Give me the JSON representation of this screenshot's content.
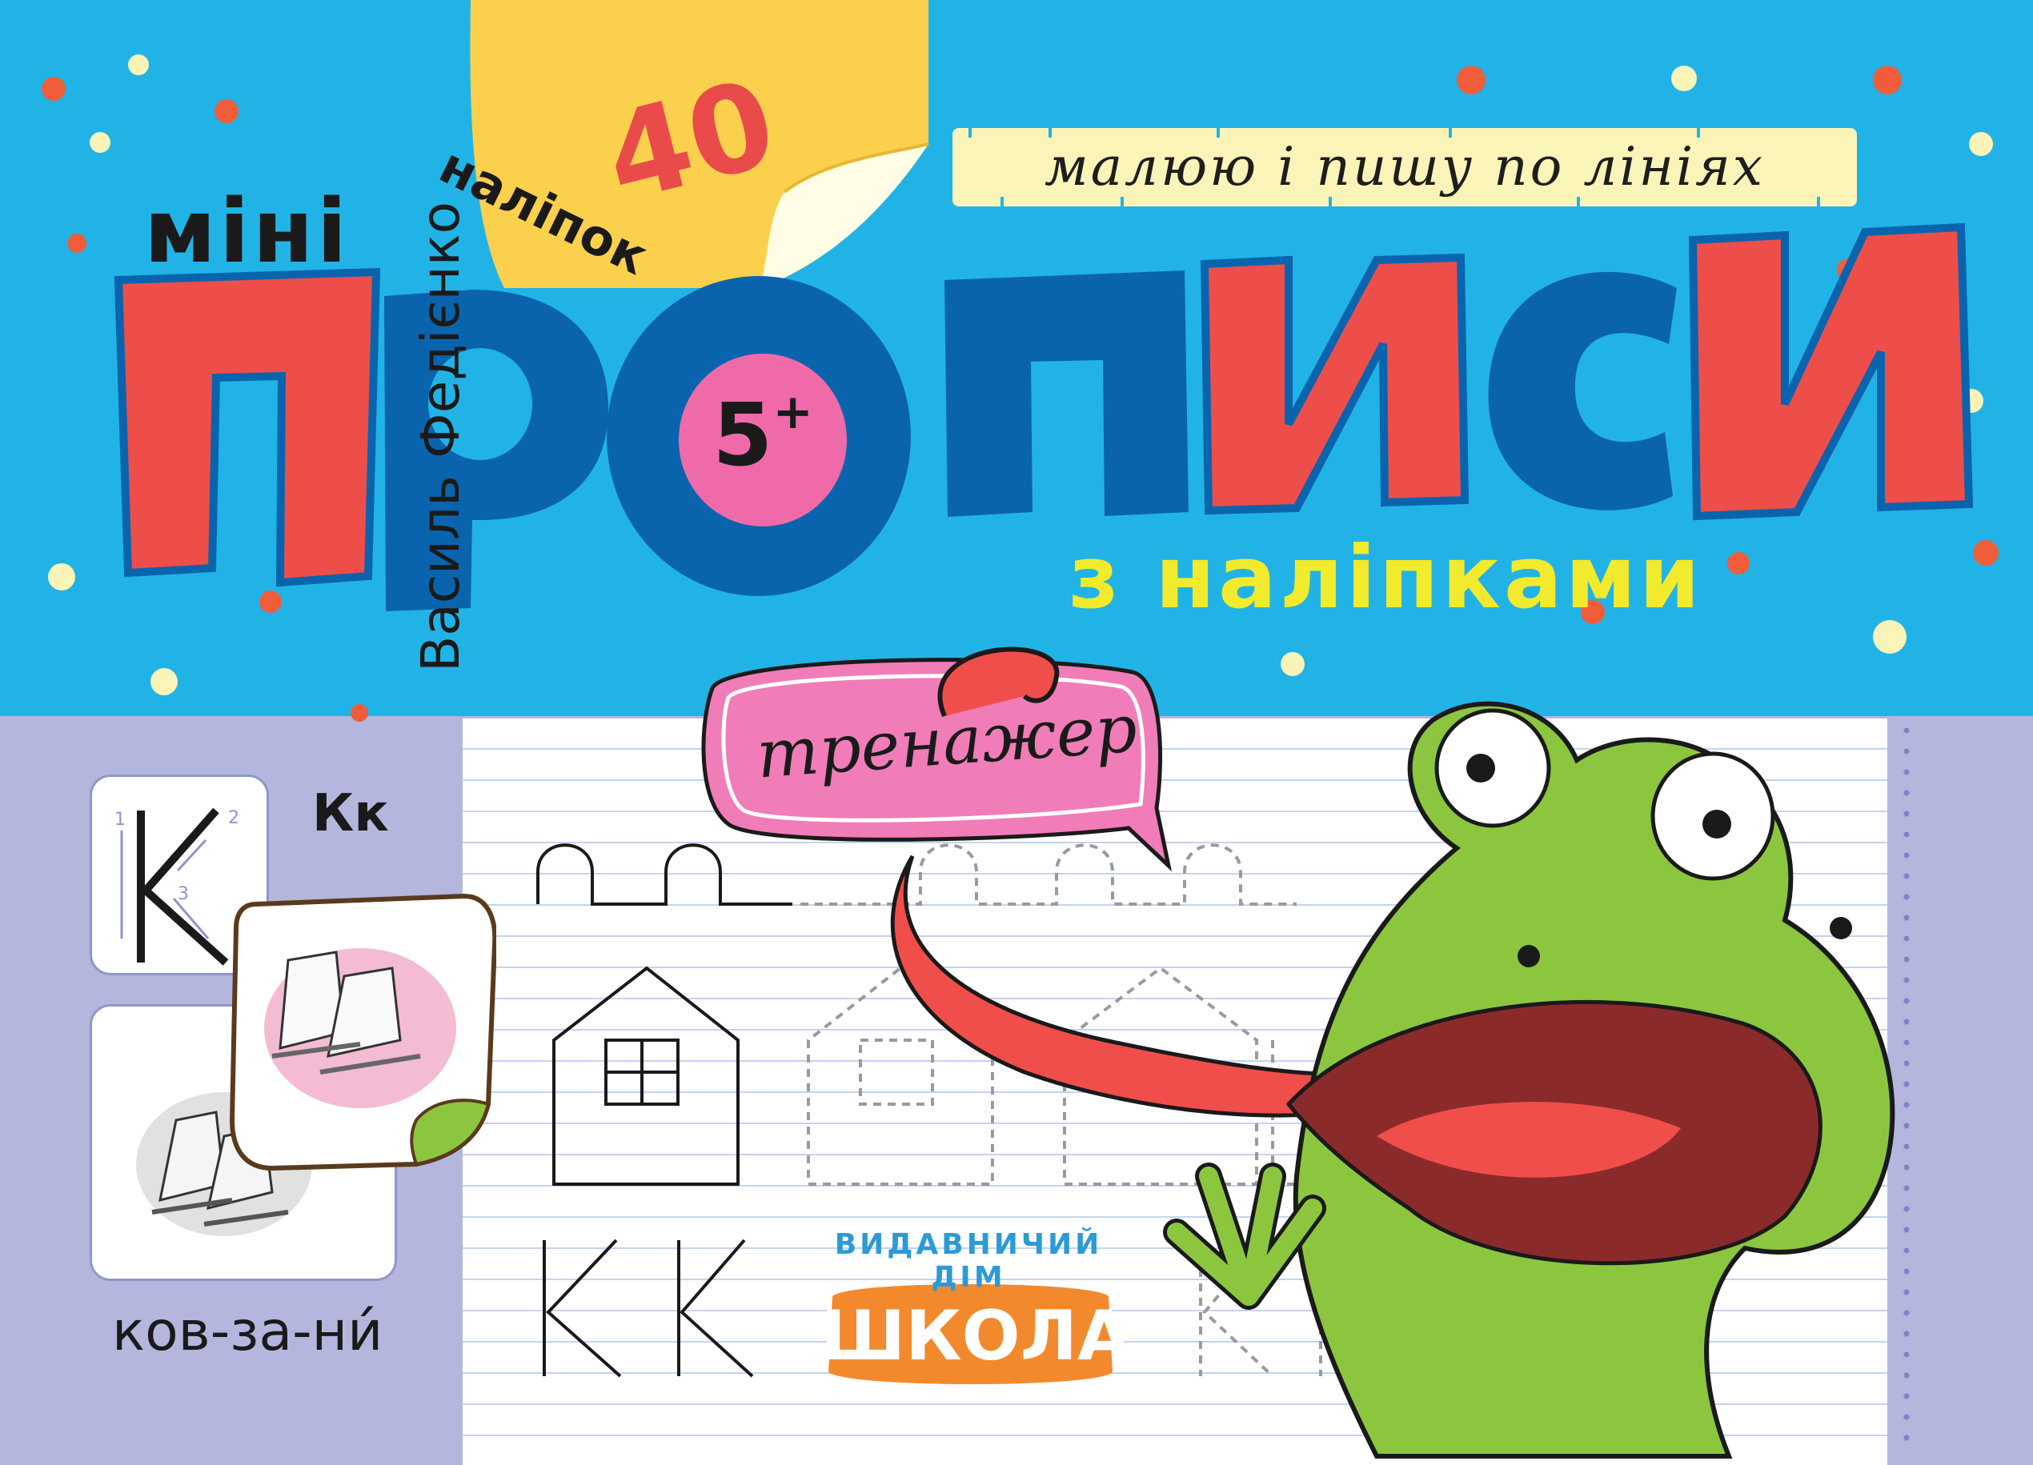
{
  "cover": {
    "top_strip_text": "малюю і пишу по лініях",
    "series_label": "міні",
    "title": "ПРОПИСИ",
    "age_badge": "5",
    "age_plus": "+",
    "sticker_count": "40",
    "sticker_word": "наліпок",
    "author": "Василь Федієнко",
    "subtitle": "з наліпками",
    "tag_label": "тренажер"
  },
  "lesson": {
    "letter_pair": "Кк",
    "stroke_numbers": [
      "1",
      "2",
      "3"
    ],
    "example_word": "ков-за-ни́"
  },
  "publisher": {
    "top_line": "ВИДАВНИЧИЙ ДІМ",
    "name": "ШКОЛА"
  },
  "colors": {
    "sky": "#22b3e6",
    "title_red": "#e94b4b",
    "title_blue": "#0a64ad",
    "badge_pink": "#ef6aa8",
    "subtitle_yellow": "#f2ea2d",
    "frog_green": "#8cc63f",
    "lilac": "#b4b6dd"
  }
}
